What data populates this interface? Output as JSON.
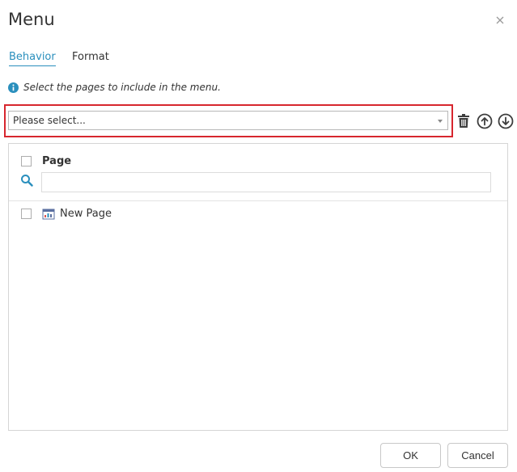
{
  "dialog": {
    "title": "Menu",
    "close_icon": "close-icon"
  },
  "tabs": [
    {
      "label": "Behavior",
      "active": true
    },
    {
      "label": "Format",
      "active": false
    }
  ],
  "info": {
    "icon": "info-icon",
    "text": "Select the pages to include in the menu."
  },
  "page_select": {
    "value": "Please select...",
    "highlight_color": "#d7262e"
  },
  "toolbar": {
    "delete_icon": "trash-icon",
    "move_up_icon": "arrow-up-circle-icon",
    "move_down_icon": "arrow-down-circle-icon"
  },
  "list": {
    "column_header": "Page",
    "search_placeholder": "",
    "items": [
      {
        "label": "New Page",
        "icon": "page-icon",
        "checked": false
      }
    ]
  },
  "footer": {
    "ok_label": "OK",
    "cancel_label": "Cancel"
  },
  "colors": {
    "accent": "#2a8fbd",
    "highlight": "#d7262e"
  }
}
